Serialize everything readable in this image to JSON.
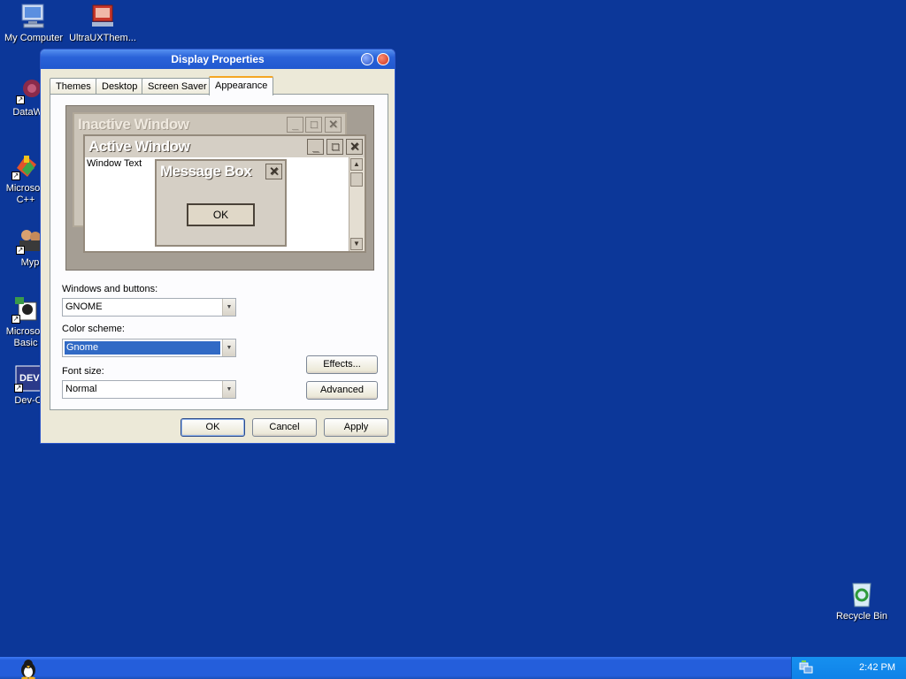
{
  "desktop": {
    "icons": [
      {
        "label": "My Computer"
      },
      {
        "label": "UltraUXThem..."
      },
      {
        "label": "DataWa"
      },
      {
        "label": "Microsoft\nC++"
      },
      {
        "label": "Myp"
      },
      {
        "label": "Microsoft\nBasic"
      },
      {
        "label": "Dev-C"
      },
      {
        "label": "Recycle Bin"
      }
    ]
  },
  "dialog": {
    "title": "Display Properties",
    "tabs": [
      "Themes",
      "Desktop",
      "Screen Saver",
      "Appearance"
    ],
    "active_tab": "Appearance",
    "preview": {
      "inactive_title": "Inactive Window",
      "active_title": "Active Window",
      "window_text": "Window Text",
      "message_title": "Message Box",
      "message_ok": "OK"
    },
    "windows_buttons_label": "Windows and buttons:",
    "windows_buttons_value": "GNOME",
    "color_scheme_label": "Color scheme:",
    "color_scheme_value": "Gnome",
    "font_size_label": "Font size:",
    "font_size_value": "Normal",
    "effects_label": "Effects...",
    "advanced_label": "Advanced",
    "ok_label": "OK",
    "cancel_label": "Cancel",
    "apply_label": "Apply"
  },
  "taskbar": {
    "clock": "2:42 PM"
  },
  "colors": {
    "desktop": "#0c3799",
    "titlebar": "#2a62d8",
    "selection": "#316ac5"
  }
}
